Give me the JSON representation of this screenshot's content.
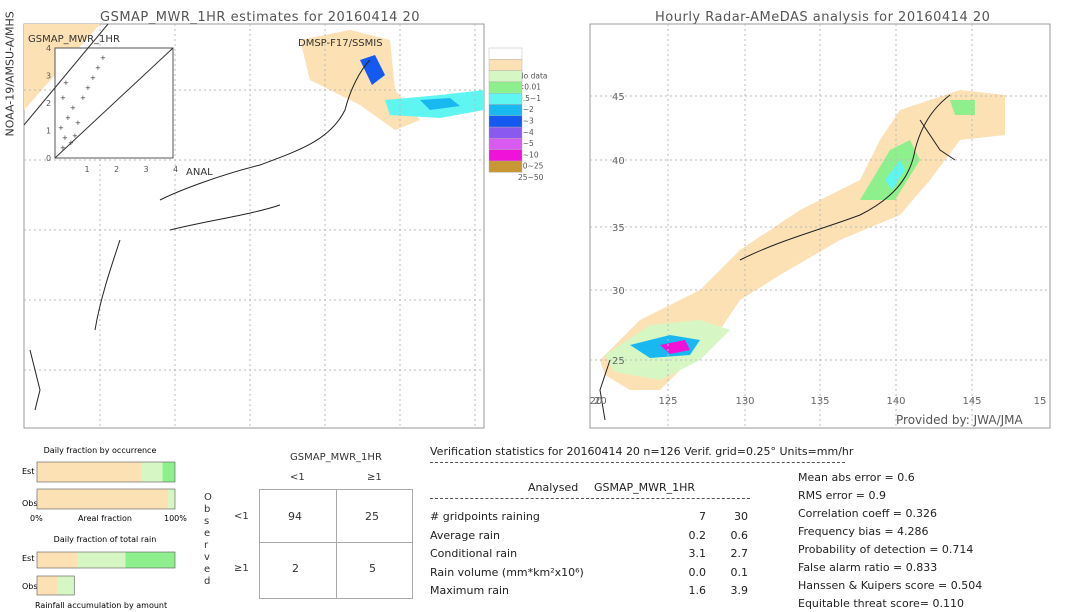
{
  "left_map": {
    "title": "GSMAP_MWR_1HR estimates for 20160414 20",
    "side_label": "NOAA-19/AMSU-A/MHS",
    "sensor_label": "DMSP-F17/SSMIS",
    "inset_title": "GSMAP_MWR_1HR",
    "inset_xlabel": "ANAL",
    "inset_ticks": [
      "0",
      "1",
      "2",
      "3",
      "4"
    ]
  },
  "right_map": {
    "title": "Hourly Radar-AMeDAS analysis for 20160414 20",
    "credit": "Provided by: JWA/JMA",
    "lon_ticks": [
      "20",
      "125",
      "130",
      "135",
      "140",
      "145",
      "15"
    ],
    "lat_ticks": [
      "45",
      "40",
      "35",
      "30",
      "25",
      "20"
    ]
  },
  "legend": {
    "items": [
      {
        "label": "",
        "color": "#ffffff"
      },
      {
        "label": "No data",
        "color": "#fbe1b4"
      },
      {
        "label": "<0.01",
        "color": "#d6f7c4"
      },
      {
        "label": "0.5~1",
        "color": "#8ef08c"
      },
      {
        "label": "1~2",
        "color": "#5ff5f0"
      },
      {
        "label": "2~3",
        "color": "#19b8f0"
      },
      {
        "label": "3~4",
        "color": "#1459f0"
      },
      {
        "label": "4~5",
        "color": "#8a5af0"
      },
      {
        "label": "5~10",
        "color": "#d85af0"
      },
      {
        "label": "10~25",
        "color": "#f012d8"
      },
      {
        "label": "25~50",
        "color": "#c89632"
      }
    ]
  },
  "chart_data": {
    "type": "table",
    "occurrence": {
      "title": "Daily fraction by occurrence",
      "xlabel": "Areal fraction",
      "x_min_label": "0%",
      "x_max_label": "100%",
      "rows": [
        {
          "label": "Est",
          "segments": [
            0.76,
            0.15,
            0.09
          ]
        },
        {
          "label": "Obs",
          "segments": [
            0.95,
            0.05,
            0.0
          ]
        }
      ]
    },
    "total_rain": {
      "title": "Daily fraction of total rain",
      "footer": "Rainfall accumulation by amount",
      "rows": [
        {
          "label": "Est",
          "segments": [
            0.29,
            0.35,
            0.36
          ]
        },
        {
          "label": "Obs",
          "segments": [
            0.15,
            0.12,
            0.0
          ]
        }
      ]
    },
    "segment_colors": [
      "#fbe1b4",
      "#d6f7c4",
      "#8ef08c"
    ],
    "contingency": {
      "title": "GSMAP_MWR_1HR",
      "observed_label": "Observed",
      "col_headers": [
        "<1",
        "≥1"
      ],
      "row_headers": [
        "<1",
        "≥1"
      ],
      "cells": [
        [
          "94",
          "25"
        ],
        [
          "2",
          "5"
        ]
      ]
    }
  },
  "stats": {
    "header": "Verification statistics for 20160414 20   n=126   Verif. grid=0.25°   Units=mm/hr",
    "col_analysed": "Analysed",
    "col_est": "GSMAP_MWR_1HR",
    "rows": [
      {
        "label": "# gridpoints raining",
        "a": "7",
        "e": "30"
      },
      {
        "label": "Average rain",
        "a": "0.2",
        "e": "0.6"
      },
      {
        "label": "Conditional rain",
        "a": "3.1",
        "e": "2.7"
      },
      {
        "label": "Rain volume (mm*km²x10⁶)",
        "a": "0.0",
        "e": "0.1"
      },
      {
        "label": "Maximum rain",
        "a": "1.6",
        "e": "3.9"
      }
    ],
    "scores": [
      "Mean abs error = 0.6",
      "RMS error = 0.9",
      "Correlation coeff = 0.326",
      "Frequency bias = 4.286",
      "Probability of detection = 0.714",
      "False alarm ratio = 0.833",
      "Hanssen & Kuipers score = 0.504",
      "Equitable threat score= 0.110"
    ]
  }
}
